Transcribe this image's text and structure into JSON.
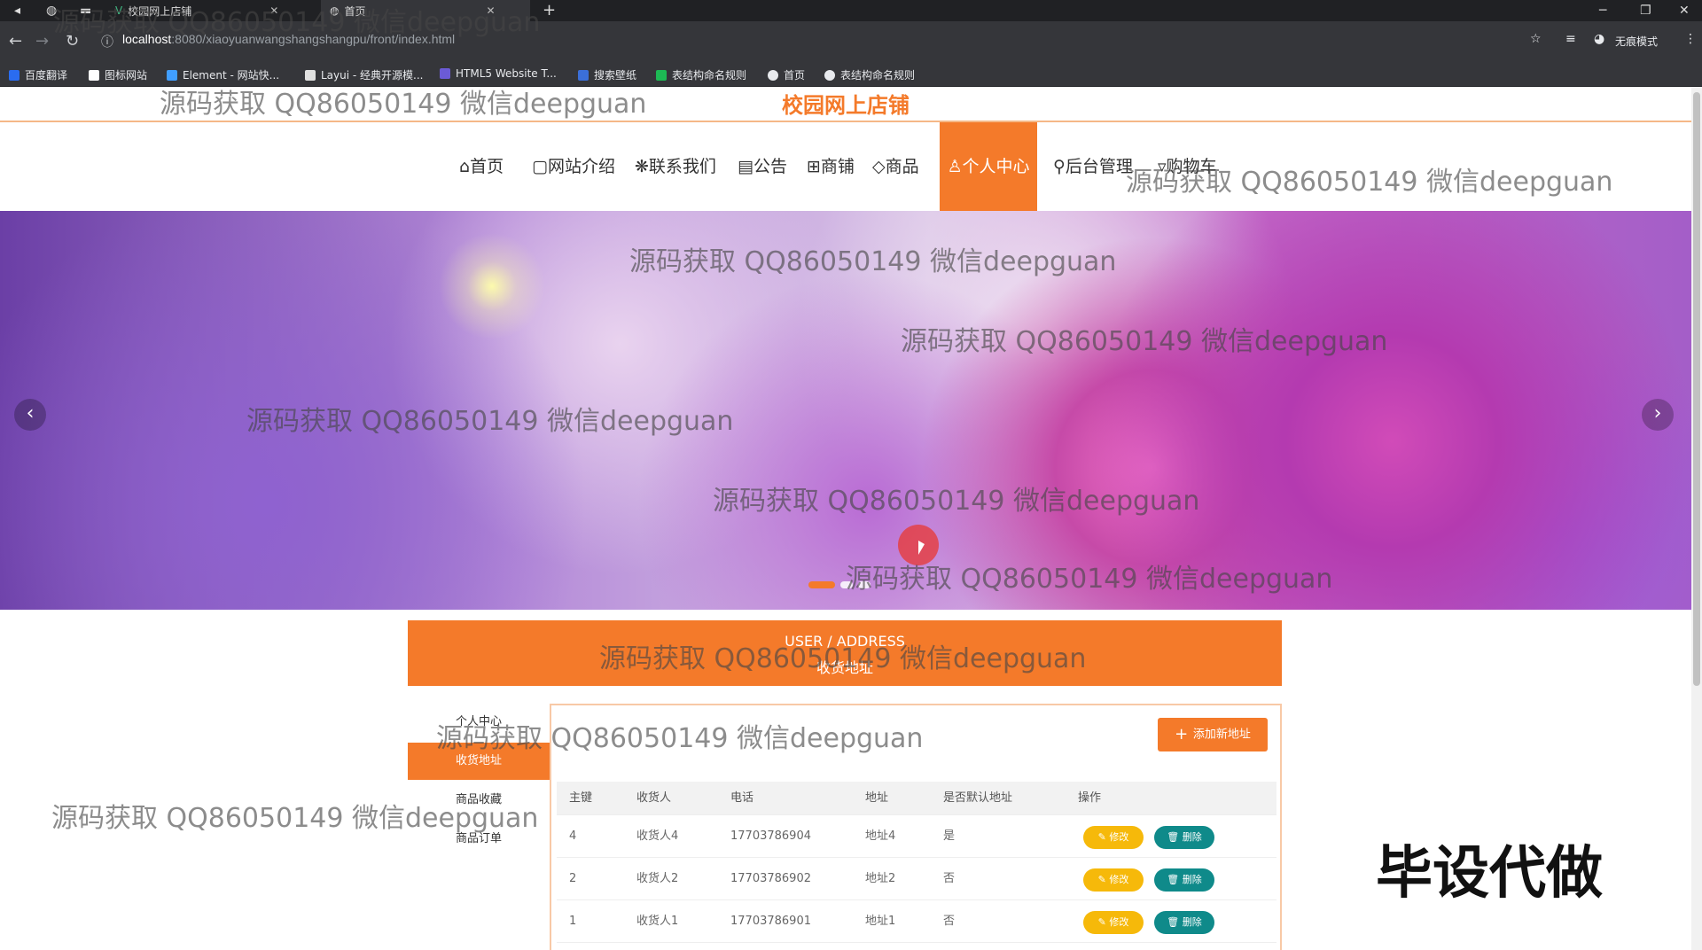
{
  "browser": {
    "tabs": [
      {
        "title": "校园网上店铺"
      },
      {
        "title": "首页"
      }
    ],
    "new_tab": "+",
    "url_host": "localhost",
    "url_path": ":8080/xiaoyuanwangshangshangpu/front/index.html",
    "profile_label": "无痕模式",
    "bookmarks": [
      {
        "label": "百度翻译",
        "color": "#2a6cf0"
      },
      {
        "label": "图标网站",
        "color": "#ffffff"
      },
      {
        "label": "Element - 网站快...",
        "color": "#409eff"
      },
      {
        "label": "Layui - 经典开源模...",
        "color": "#e0e0e0"
      },
      {
        "label": "HTML5 Website T...",
        "color": "#6b5bd6"
      },
      {
        "label": "搜索壁纸",
        "color": "#3b6fd8"
      },
      {
        "label": "表结构命名规则",
        "color": "#1db954"
      },
      {
        "label": "首页",
        "color": "#e8eaed"
      },
      {
        "label": "表结构命名规则",
        "color": "#e8eaed"
      }
    ]
  },
  "site": {
    "title": "校园网上店铺"
  },
  "nav": {
    "items": [
      {
        "icon": "⌂",
        "label": "首页"
      },
      {
        "icon": "▢",
        "label": "网站介绍"
      },
      {
        "icon": "❋",
        "label": "联系我们"
      },
      {
        "icon": "▤",
        "label": "公告"
      },
      {
        "icon": "⊞",
        "label": "商铺"
      },
      {
        "icon": "◇",
        "label": "商品"
      },
      {
        "icon": "♙",
        "label": "个人中心"
      },
      {
        "icon": "⚲",
        "label": "后台管理"
      },
      {
        "icon": "▿",
        "label": "购物车"
      }
    ],
    "active_index": 6
  },
  "banner": {
    "prev": "‹",
    "next": "›",
    "slide_count": 3,
    "active_slide": 0
  },
  "section": {
    "title_en": "USER / ADDRESS",
    "title_cn": "收货地址"
  },
  "sidebar": {
    "heading": "个人中心",
    "items": [
      "收货地址",
      "商品收藏",
      "商品订单"
    ],
    "active_index": 0
  },
  "address_table": {
    "add_button": "添加新地址",
    "columns": [
      "主键",
      "收货人",
      "电话",
      "地址",
      "是否默认地址",
      "操作"
    ],
    "rows": [
      {
        "id": "4",
        "name": "收货人4",
        "phone": "17703786904",
        "address": "地址4",
        "default": "是"
      },
      {
        "id": "2",
        "name": "收货人2",
        "phone": "17703786902",
        "address": "地址2",
        "default": "否"
      },
      {
        "id": "1",
        "name": "收货人1",
        "phone": "17703786901",
        "address": "地址1",
        "default": "否"
      }
    ],
    "edit_label": "修改",
    "delete_label": "删除"
  },
  "watermark": "源码获取 QQ86050149 微信deepguan",
  "stamp": "毕设代做",
  "colors": {
    "accent": "#f47a2a",
    "edit": "#f6b90a",
    "delete": "#0f8a8a"
  }
}
